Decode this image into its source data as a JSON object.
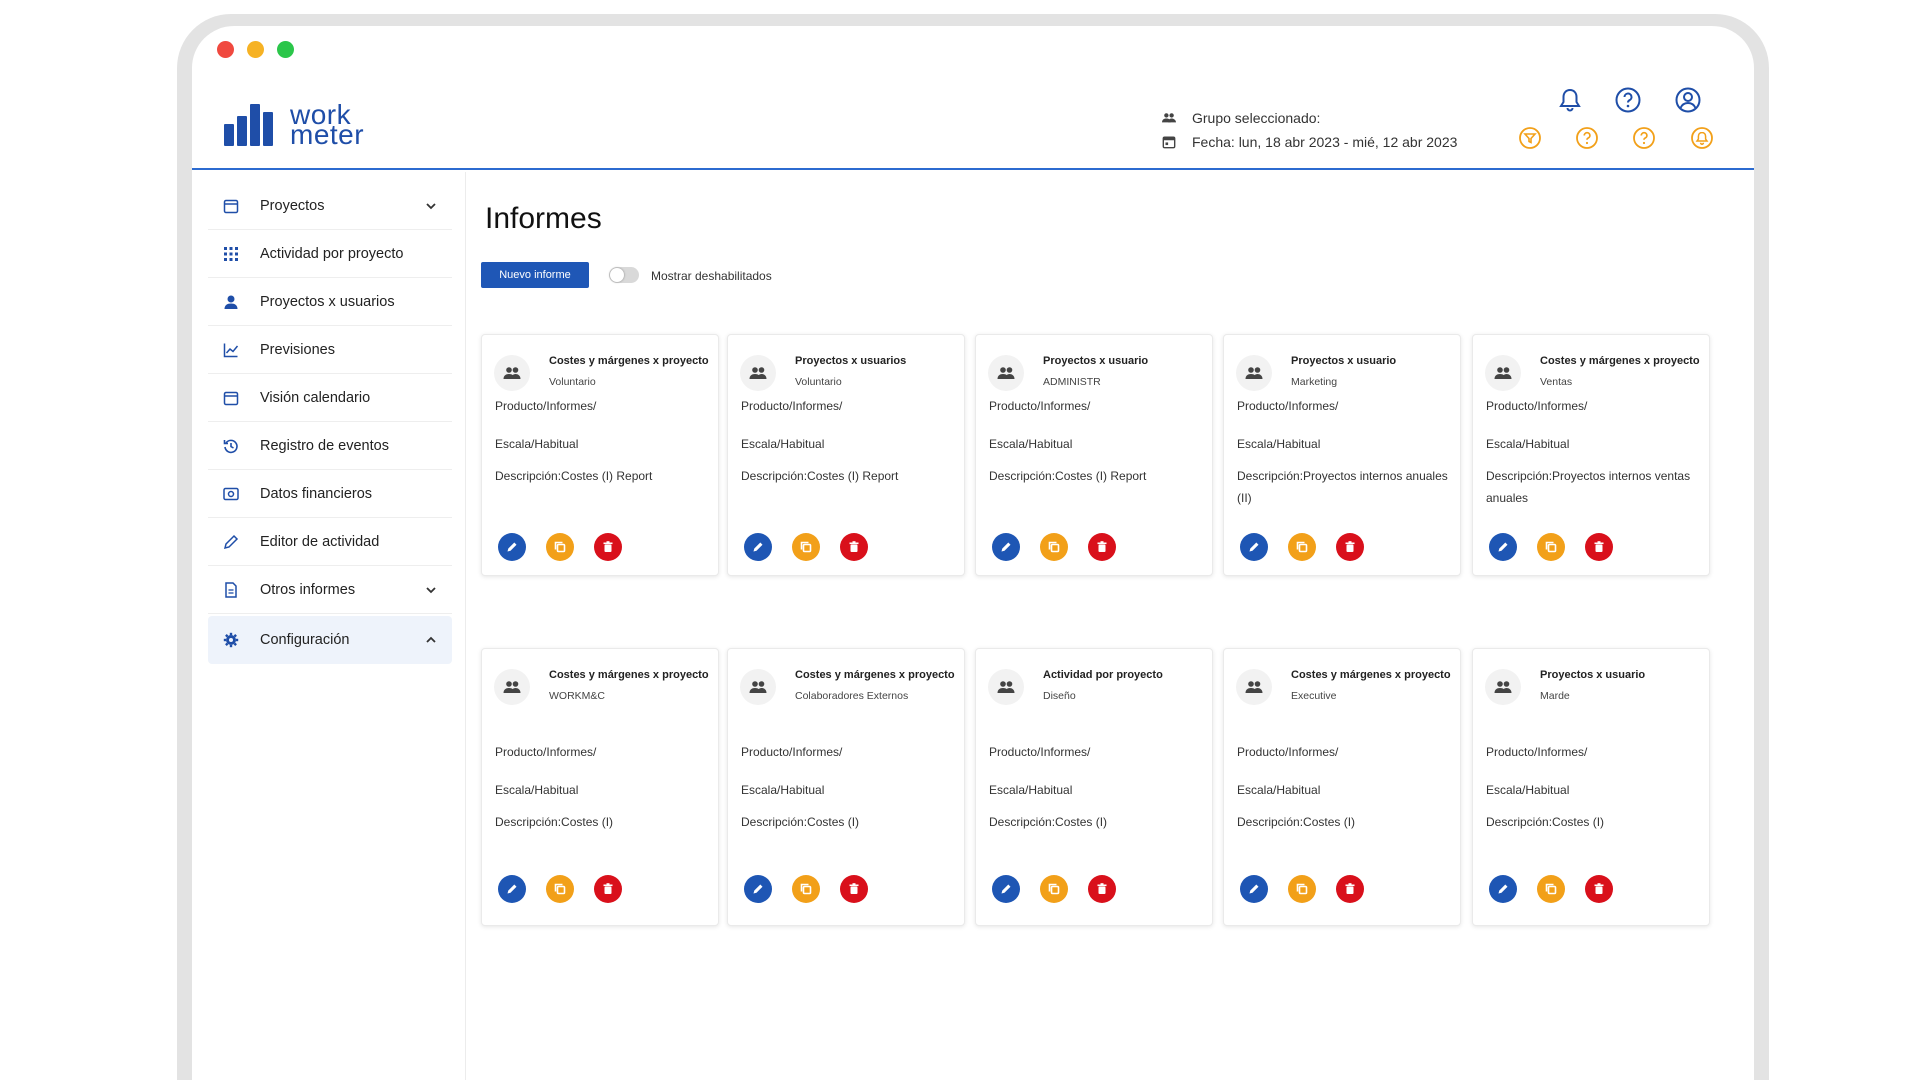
{
  "app": {
    "logo_line1": "work",
    "logo_line2": "meter"
  },
  "header": {
    "group_label": "Grupo seleccionado:",
    "date_label": "Fecha: lun, 18 abr 2023 - mié, 12 abr 2023",
    "icons_top": [
      "bell-icon",
      "help-circle-icon",
      "user-circle-icon"
    ],
    "icons_bottom": [
      "filter-icon",
      "help-icon",
      "help-icon",
      "alert-icon"
    ],
    "accent": "#2c6bd0",
    "warning_color": "#f2a019"
  },
  "sidebar": {
    "items": [
      {
        "label": "Proyectos",
        "icon": "calendar-icon",
        "expand": "down"
      },
      {
        "label": "Actividad por proyecto",
        "icon": "grid-icon"
      },
      {
        "label": "Proyectos x usuarios",
        "icon": "person-icon"
      },
      {
        "label": "Previsiones",
        "icon": "chart-line-icon"
      },
      {
        "label": "Visión calendario",
        "icon": "calendar-icon"
      },
      {
        "label": "Registro de eventos",
        "icon": "history-icon"
      },
      {
        "label": "Datos financieros",
        "icon": "money-icon"
      },
      {
        "label": "Editor de actividad",
        "icon": "pencil-icon"
      },
      {
        "label": "Otros informes",
        "icon": "document-icon",
        "expand": "down"
      },
      {
        "label": "Configuración",
        "icon": "gear-icon",
        "expand": "up",
        "active": true
      }
    ]
  },
  "main": {
    "title": "Informes",
    "new_button": "Nuevo informe",
    "toggle_label": "Mostrar deshabilitados",
    "toggle_on": false,
    "cards": [
      {
        "title": "Costes y márgenes x proyecto",
        "subtitle": "Voluntario",
        "path": "Producto/Informes/",
        "scale": "Escala/Habitual",
        "description": "Descripción:Costes (I) Report"
      },
      {
        "title": "Proyectos x usuarios",
        "subtitle": "Voluntario",
        "path": "Producto/Informes/",
        "scale": "Escala/Habitual",
        "description": "Descripción:Costes (I) Report"
      },
      {
        "title": "Proyectos x usuario",
        "subtitle": "ADMINISTR",
        "path": "Producto/Informes/",
        "scale": "Escala/Habitual",
        "description": "Descripción:Costes (I) Report"
      },
      {
        "title": "Proyectos x usuario",
        "subtitle": "Marketing",
        "path": "Producto/Informes/",
        "scale": "Escala/Habitual",
        "description": "Descripción:Proyectos internos anuales (II)"
      },
      {
        "title": "Costes y márgenes x proyecto",
        "subtitle": "Ventas",
        "path": "Producto/Informes/",
        "scale": "Escala/Habitual",
        "description": "Descripción:Proyectos internos ventas anuales"
      },
      {
        "title": "Costes y márgenes x proyecto",
        "subtitle": "WORKM&C",
        "path": "Producto/Informes/",
        "scale": "Escala/Habitual",
        "description": "Descripción:Costes (I)"
      },
      {
        "title": "Costes y márgenes x proyecto",
        "subtitle": "Colaboradores Externos",
        "path": "Producto/Informes/",
        "scale": "Escala/Habitual",
        "description": "Descripción:Costes (I)"
      },
      {
        "title": "Actividad por proyecto",
        "subtitle": "Diseño",
        "path": "Producto/Informes/",
        "scale": "Escala/Habitual",
        "description": "Descripción:Costes (I)"
      },
      {
        "title": "Costes y márgenes x proyecto",
        "subtitle": "Executive",
        "path": "Producto/Informes/",
        "scale": "Escala/Habitual",
        "description": "Descripción:Costes (I)"
      },
      {
        "title": "Proyectos x usuario",
        "subtitle": "Marde",
        "path": "Producto/Informes/",
        "scale": "Escala/Habitual",
        "description": "Descripción:Costes (I)"
      }
    ],
    "card_actions": [
      {
        "name": "edit",
        "icon": "pencil-icon",
        "color": "#1e56b4"
      },
      {
        "name": "copy",
        "icon": "copy-icon",
        "color": "#f2a019"
      },
      {
        "name": "delete",
        "icon": "trash-icon",
        "color": "#d9101b"
      }
    ]
  }
}
